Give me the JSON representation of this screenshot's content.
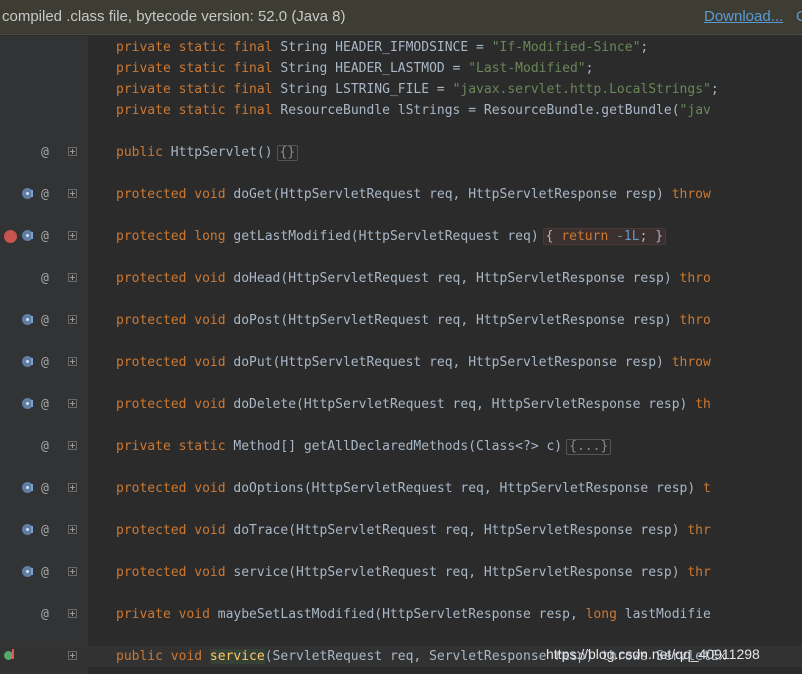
{
  "banner": {
    "text": "compiled .class file, bytecode version: 52.0 (Java 8)",
    "download_label": "Download...",
    "extra_label": "C"
  },
  "code_lines": [
    {
      "parts": [
        [
          "kw",
          "private static final "
        ],
        [
          "t",
          "String HEADER_IFMODSINCE = "
        ],
        [
          "str",
          "\"If-Modified-Since\""
        ],
        [
          "t",
          ";"
        ]
      ]
    },
    {
      "parts": [
        [
          "kw",
          "private static final "
        ],
        [
          "t",
          "String HEADER_LASTMOD = "
        ],
        [
          "str",
          "\"Last-Modified\""
        ],
        [
          "t",
          ";"
        ]
      ]
    },
    {
      "parts": [
        [
          "kw",
          "private static final "
        ],
        [
          "t",
          "String LSTRING_FILE = "
        ],
        [
          "str",
          "\"javax.servlet.http.LocalStrings\""
        ],
        [
          "t",
          ";"
        ]
      ]
    },
    {
      "parts": [
        [
          "kw",
          "private static final "
        ],
        [
          "t",
          "ResourceBundle lStrings = ResourceBundle.getBundle("
        ],
        [
          "str",
          "\"jav"
        ]
      ]
    }
  ],
  "methods": [
    {
      "text_before": "public ",
      "kw": "public ",
      "sig": "HttpServlet()",
      "fold": "{}",
      "override": false,
      "breakpoint": false
    },
    {
      "kw": "protected void ",
      "sig": "doGet(HttpServletRequest req, HttpServletResponse resp) ",
      "tail": "throw",
      "override": true
    },
    {
      "kw": "protected long ",
      "sig": "getLastModified(HttpServletRequest req)",
      "fold_return": "return -1L;",
      "override": true,
      "breakpoint": true
    },
    {
      "kw": "protected void ",
      "sig": "doHead(HttpServletRequest req, HttpServletResponse resp) ",
      "tail": "thro",
      "override": false
    },
    {
      "kw": "protected void ",
      "sig": "doPost(HttpServletRequest req, HttpServletResponse resp) ",
      "tail": "thro",
      "override": true
    },
    {
      "kw": "protected void ",
      "sig": "doPut(HttpServletRequest req, HttpServletResponse resp) ",
      "tail": "throw",
      "override": true
    },
    {
      "kw": "protected void ",
      "sig": "doDelete(HttpServletRequest req, HttpServletResponse resp) ",
      "tail": "th",
      "override": true
    },
    {
      "kw": "private static ",
      "sig": "Method[] getAllDeclaredMethods(Class<?> c)",
      "fold": "{...}",
      "override": false
    },
    {
      "kw": "protected void ",
      "sig": "doOptions(HttpServletRequest req, HttpServletResponse resp) ",
      "tail": "t",
      "override": true
    },
    {
      "kw": "protected void ",
      "sig": "doTrace(HttpServletRequest req, HttpServletResponse resp) ",
      "tail": "thr",
      "override": true
    },
    {
      "kw": "protected void ",
      "sig": "service(HttpServletRequest req, HttpServletResponse resp) ",
      "tail": "thr",
      "override": true
    },
    {
      "kw": "private void ",
      "sig": "maybeSetLastModified(HttpServletResponse resp, ",
      "kw2": "long ",
      "sig2": "lastModifie",
      "override": false
    }
  ],
  "last_line": {
    "kw": "public void ",
    "fn": "service",
    "rest": "(ServletRequest req, ServletResponse resp) throws ServletEx"
  },
  "watermark": "https://blog.csdn.net/qq_40911298"
}
